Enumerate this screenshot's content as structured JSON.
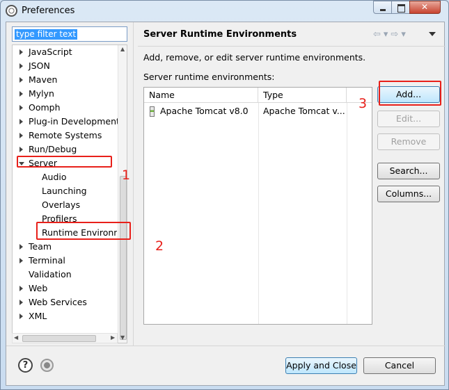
{
  "window": {
    "title": "Preferences"
  },
  "filter": {
    "value": "type filter text"
  },
  "tree": {
    "items": [
      {
        "label": "JavaScript",
        "expandable": true
      },
      {
        "label": "JSON",
        "expandable": true
      },
      {
        "label": "Maven",
        "expandable": true
      },
      {
        "label": "Mylyn",
        "expandable": true
      },
      {
        "label": "Oomph",
        "expandable": true
      },
      {
        "label": "Plug-in Development",
        "expandable": true
      },
      {
        "label": "Remote Systems",
        "expandable": true
      },
      {
        "label": "Run/Debug",
        "expandable": true
      },
      {
        "label": "Server",
        "expandable": true,
        "expanded": true
      },
      {
        "label": "Audio",
        "child": true
      },
      {
        "label": "Launching",
        "child": true
      },
      {
        "label": "Overlays",
        "child": true
      },
      {
        "label": "Profilers",
        "child": true
      },
      {
        "label": "Runtime Environm",
        "child": true,
        "selected": true
      },
      {
        "label": "Team",
        "expandable": true
      },
      {
        "label": "Terminal",
        "expandable": true
      },
      {
        "label": "Validation",
        "expandable": false
      },
      {
        "label": "Web",
        "expandable": true
      },
      {
        "label": "Web Services",
        "expandable": true
      },
      {
        "label": "XML",
        "expandable": true
      }
    ]
  },
  "page": {
    "title": "Server Runtime Environments",
    "description": "Add, remove, or edit server runtime environments.",
    "list_label": "Server runtime environments:"
  },
  "table": {
    "columns": [
      "Name",
      "Type"
    ],
    "rows": [
      {
        "name": "Apache Tomcat v8.0",
        "type": "Apache Tomcat v..."
      }
    ]
  },
  "buttons": {
    "add": "Add...",
    "edit": "Edit...",
    "remove": "Remove",
    "search": "Search...",
    "columns": "Columns..."
  },
  "footer": {
    "apply_close": "Apply and Close",
    "cancel": "Cancel"
  },
  "annotations": {
    "one": "1",
    "two": "2",
    "three": "3"
  },
  "colors": {
    "annotation": "#e8201a",
    "selection": "#3399ff"
  }
}
